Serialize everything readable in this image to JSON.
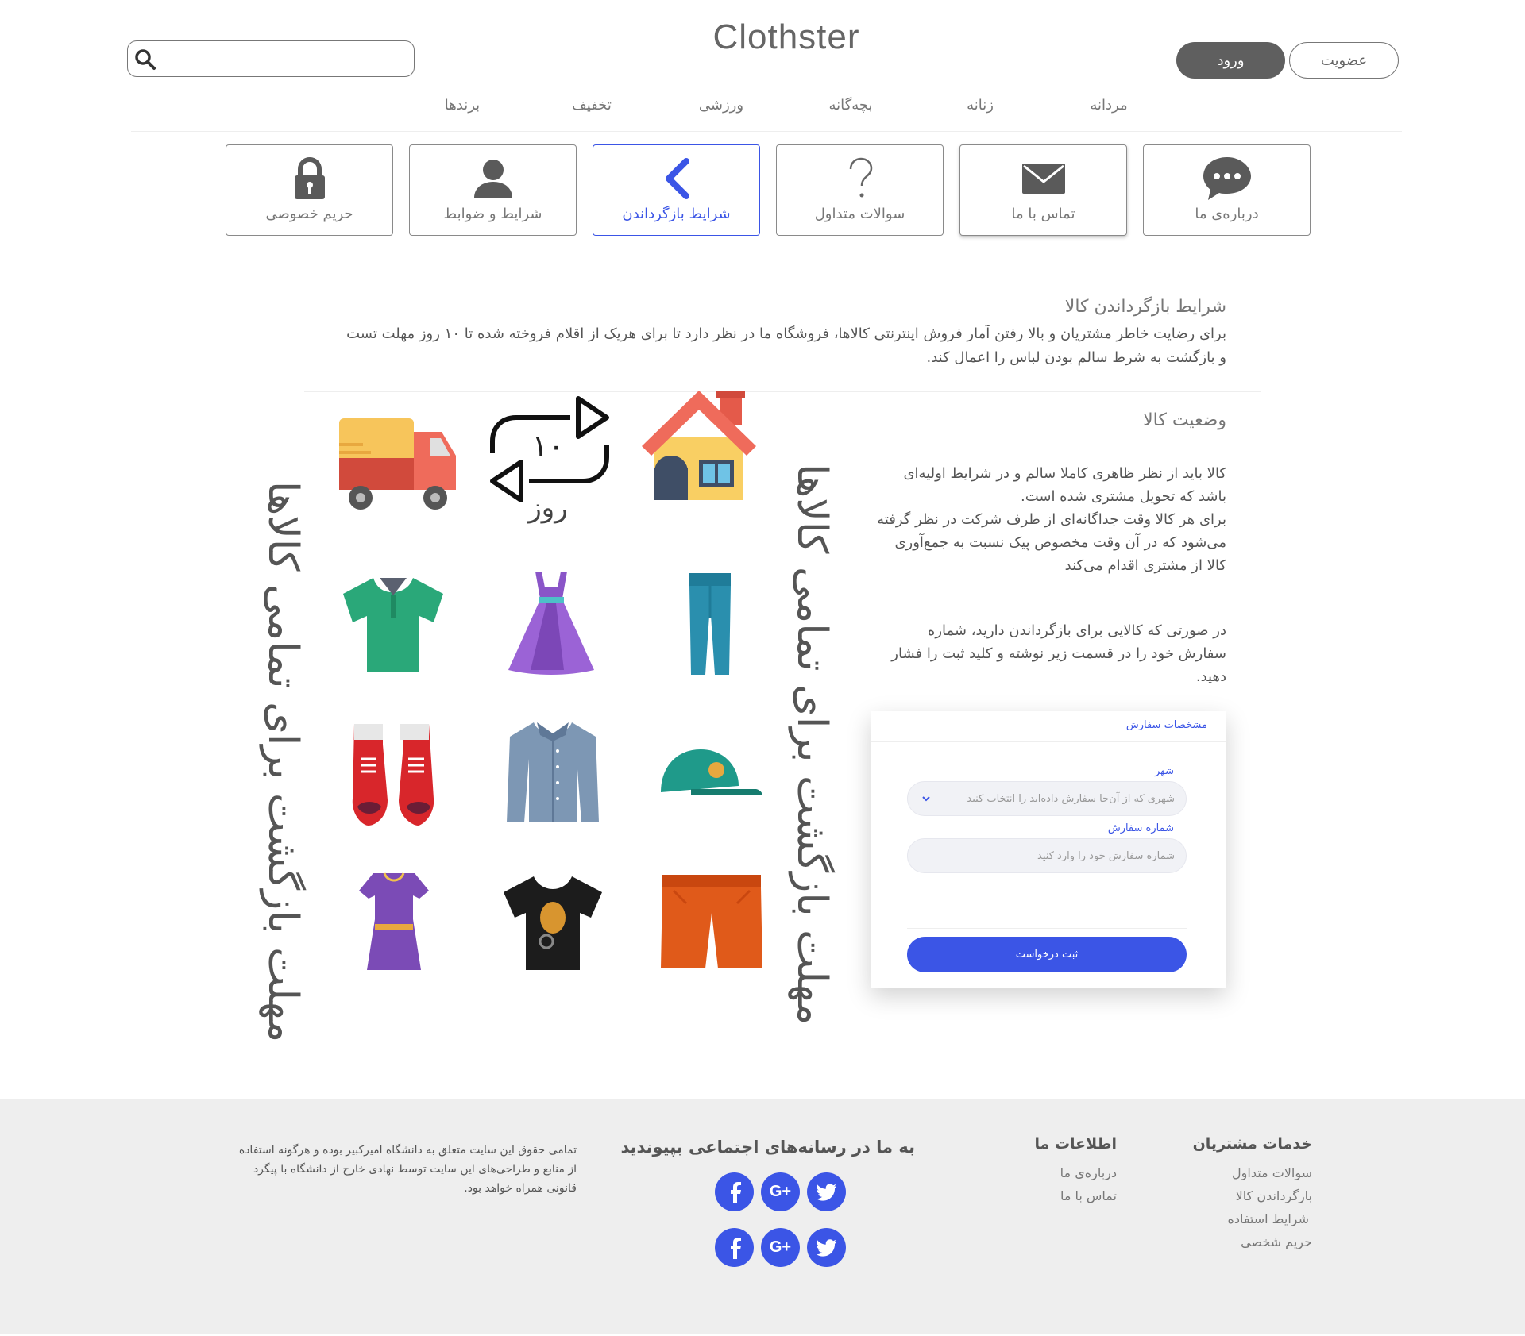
{
  "header": {
    "logo": "Clothster",
    "login_label": "ورود",
    "signup_label": "عضویت"
  },
  "nav": [
    "مردانه",
    "زنانه",
    "بچه‌گانه",
    "ورزشی",
    "تخفیف",
    "برندها"
  ],
  "cards": [
    {
      "label": "درباره‌ی ما",
      "icon": "chat-bubble-icon"
    },
    {
      "label": "تماس با ما",
      "icon": "envelope-icon"
    },
    {
      "label": "سوالات متداول",
      "icon": "question-icon"
    },
    {
      "label": "شرایط بازگرداندن",
      "icon": "chevron-left-icon",
      "active": true
    },
    {
      "label": "شرایط و ضوابط",
      "icon": "user-icon"
    },
    {
      "label": "حریم خصوصی",
      "icon": "lock-icon"
    }
  ],
  "content": {
    "title": "شرایط بازگرداندن کالا",
    "intro_line1": "برای رضایت خاطر مشتریان و بالا رفتن آمار فروش اینترنتی کالاها، فروشگاه ما در نظر دارد تا برای هریک از اقلام فروخته شده تا ۱۰ روز مهلت تست",
    "intro_line2": "و بازگشت به شرط سالم بودن لباس را اعمال کند.",
    "status_title": "وضعیت کالا",
    "status_p1": "کالا باید از نظر ظاهری کاملا سالم و در شرایط اولیه‌ای باشد که تحویل مشتری شده است.",
    "status_p2": "برای هر کالا وقت جداگانه‌ای از طرف شرکت در نظر گرفته می‌شود که در آن وقت مخصوص پیک نسبت به جمع‌آوری کالا از مشتری اقدام می‌کند",
    "status_p3": "در صورتی که کالایی برای بازگرداندن دارید، شماره سفارش خود را در قسمت زیر نوشته و کلید ثبت را فشار دهید.",
    "banner_text": "مهلت بازگشت برای تمامی کالاها",
    "days": "۱۰",
    "days_unit": "روز"
  },
  "form": {
    "title": "مشخصات سفارش",
    "city_label": "شهر",
    "city_placeholder": "شهری که از آن‌جا سفارش داده‌اید را انتخاب کنید",
    "order_label": "شماره سفارش",
    "order_placeholder": "شماره سفارش خود را وارد کنید",
    "submit_label": "ثبت درخواست"
  },
  "footer": {
    "services_title": "خدمات مشتریان",
    "services_links": [
      "سوالات متداول",
      "بازگرداندن کالا",
      "شرایط استفاده",
      "حریم شخصی"
    ],
    "info_title": "اطلاعات ما",
    "info_links": [
      "درباره‌ی ما",
      "تماس با ما"
    ],
    "social_title": "به ما در رسانه‌های اجتماعی بپیوندید",
    "copyright": "تمامی حقوق این سایت متعلق به دانشگاه امیرکبیر بوده و هرگونه استفاده از منابع و طراحی‌های این سایت توسط نهادی خارج از دانشگاه با پیگرد قانونی همراه خواهد بود."
  },
  "colors": {
    "accent": "#3b55e6",
    "footer_bg": "#eeeeee",
    "button_dark": "#5f5f5f"
  }
}
